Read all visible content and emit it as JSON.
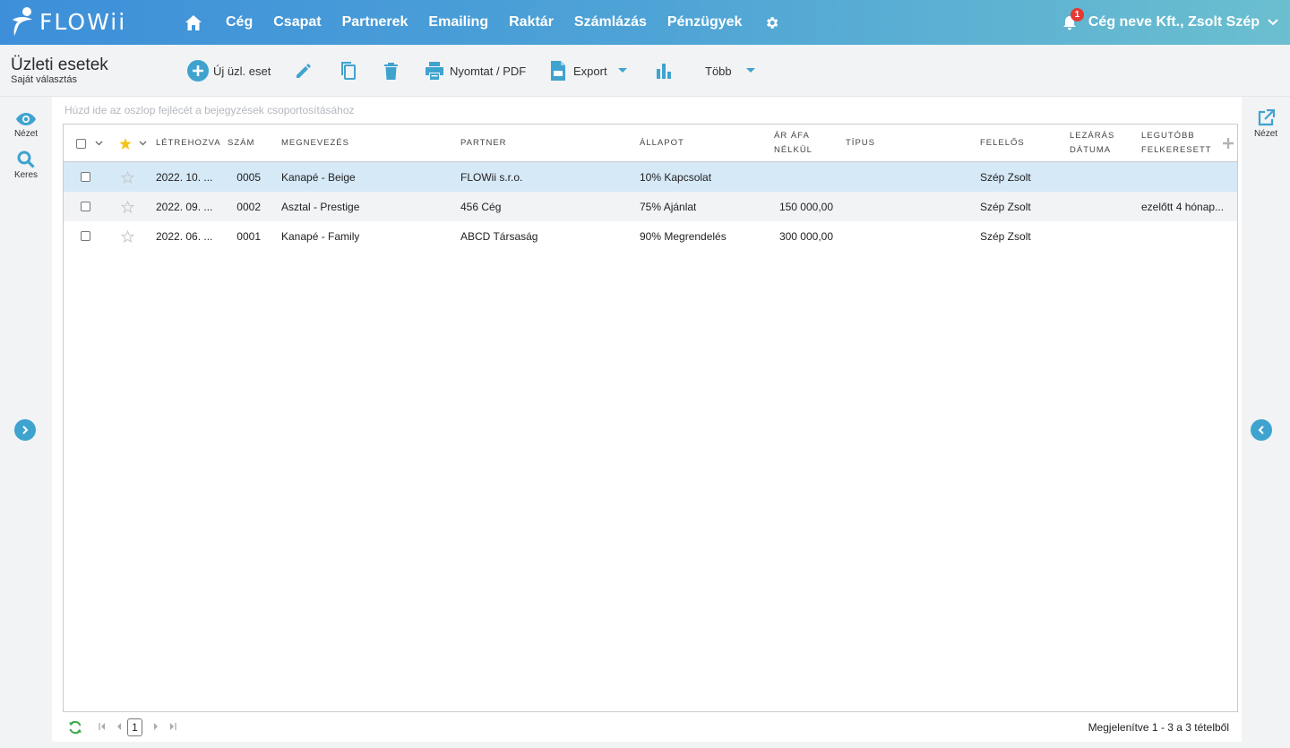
{
  "app": {
    "logo_text": "FLOWii"
  },
  "nav": {
    "items": [
      "Cég",
      "Csapat",
      "Partnerek",
      "Emailing",
      "Raktár",
      "Számlázás",
      "Pénzügyek"
    ],
    "notification_count": "1",
    "user_label": "Cég neve Kft., Zsolt Szép"
  },
  "page": {
    "title": "Üzleti esetek",
    "subtitle": "Saját választás"
  },
  "toolbar": {
    "new_label": "Új üzl. eset",
    "print_label": "Nyomtat / PDF",
    "export_label": "Export",
    "more_label": "Több"
  },
  "left_rail": {
    "view_label": "Nézet",
    "search_label": "Keres"
  },
  "right_rail": {
    "view_label": "Nézet"
  },
  "grid": {
    "group_hint": "Húzd ide az oszlop fejlécét a bejegyzések csoportosításához",
    "columns": {
      "created": "Létrehozva",
      "number": "Szám",
      "name": "Megnevezés",
      "partner": "Partner",
      "status": "Állapot",
      "price_line1": "Ár áfa",
      "price_line2": "nélkül",
      "type": "Típus",
      "owner": "Felelős",
      "close_line1": "Lezárás",
      "close_line2": "dátuma",
      "visited_line1": "Legutóbb",
      "visited_line2": "felkeresett"
    },
    "rows": [
      {
        "created": "2022. 10. ...",
        "number": "0005",
        "name": "Kanapé - Beige",
        "partner": "FLOWii s.r.o.",
        "status": "10% Kapcsolat",
        "price": "",
        "type": "",
        "owner": "Szép Zsolt",
        "close": "",
        "visited": ""
      },
      {
        "created": "2022. 09. ...",
        "number": "0002",
        "name": "Asztal - Prestige",
        "partner": "456 Cég",
        "status": "75% Ajánlat",
        "price": "150 000,00",
        "type": "",
        "owner": "Szép Zsolt",
        "close": "",
        "visited": "ezelőtt  4 hónap..."
      },
      {
        "created": "2022. 06. ...",
        "number": "0001",
        "name": "Kanapé - Family",
        "partner": "ABCD Társaság",
        "status": "90% Megrendelés",
        "price": "300 000,00",
        "type": "",
        "owner": "Szép Zsolt",
        "close": "",
        "visited": ""
      }
    ]
  },
  "footer": {
    "current_page": "1",
    "summary": "Megjelenítve 1 - 3 a 3 tételből"
  },
  "colors": {
    "accent": "#3fa3cf",
    "header_start": "#3d8fd9",
    "header_end": "#6bbfcf",
    "selected_row": "#d6e9f7",
    "star": "#f5c518"
  }
}
